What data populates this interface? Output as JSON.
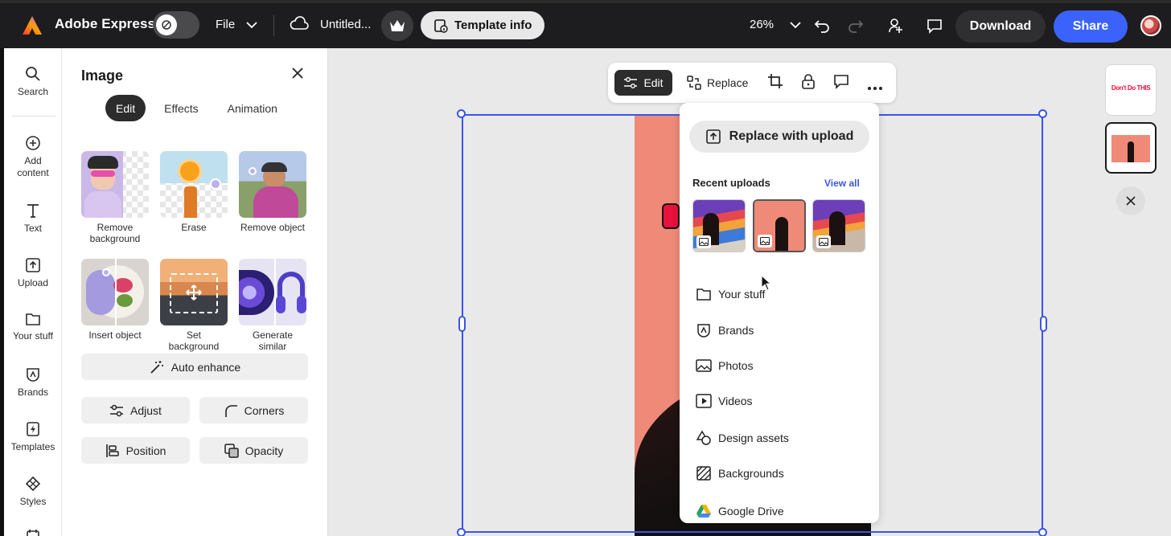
{
  "app": {
    "name": "Adobe Express"
  },
  "topbar": {
    "file_label": "File",
    "doc_title": "Untitled...",
    "template_info_label": "Template info",
    "zoom": "26%",
    "download_label": "Download",
    "share_label": "Share"
  },
  "rail": {
    "items": [
      {
        "label": "Search",
        "icon": "search-icon"
      },
      {
        "label": "Add\ncontent",
        "icon": "plus-circle-icon"
      },
      {
        "label": "Text",
        "icon": "text-icon"
      },
      {
        "label": "Upload",
        "icon": "upload-icon"
      },
      {
        "label": "Your stuff",
        "icon": "folder-icon"
      },
      {
        "label": "Brands",
        "icon": "brands-icon"
      },
      {
        "label": "Templates",
        "icon": "templates-icon"
      },
      {
        "label": "Styles",
        "icon": "styles-icon"
      }
    ]
  },
  "panel": {
    "title": "Image",
    "tabs": [
      "Edit",
      "Effects",
      "Animation"
    ],
    "active_tab": "Edit",
    "tools": [
      {
        "label": "Remove background"
      },
      {
        "label": "Erase"
      },
      {
        "label": "Remove object"
      },
      {
        "label": "Insert object"
      },
      {
        "label": "Set background"
      },
      {
        "label": "Generate similar"
      }
    ],
    "auto_enhance": "Auto enhance",
    "adjust": "Adjust",
    "corners": "Corners",
    "position": "Position",
    "opacity": "Opacity"
  },
  "context_toolbar": {
    "edit_label": "Edit",
    "replace_label": "Replace"
  },
  "replace_menu": {
    "upload_label": "Replace with upload",
    "recent_label": "Recent uploads",
    "view_all_label": "View all",
    "items": [
      "Your stuff",
      "Brands",
      "Photos",
      "Videos",
      "Design assets",
      "Backgrounds",
      "Google Drive"
    ]
  },
  "pages": {
    "thumb1_text": "Don't Do THIS"
  },
  "colors": {
    "accent": "#3b63fb",
    "selection": "#3b55e6",
    "photo_bg": "#f08a78"
  }
}
